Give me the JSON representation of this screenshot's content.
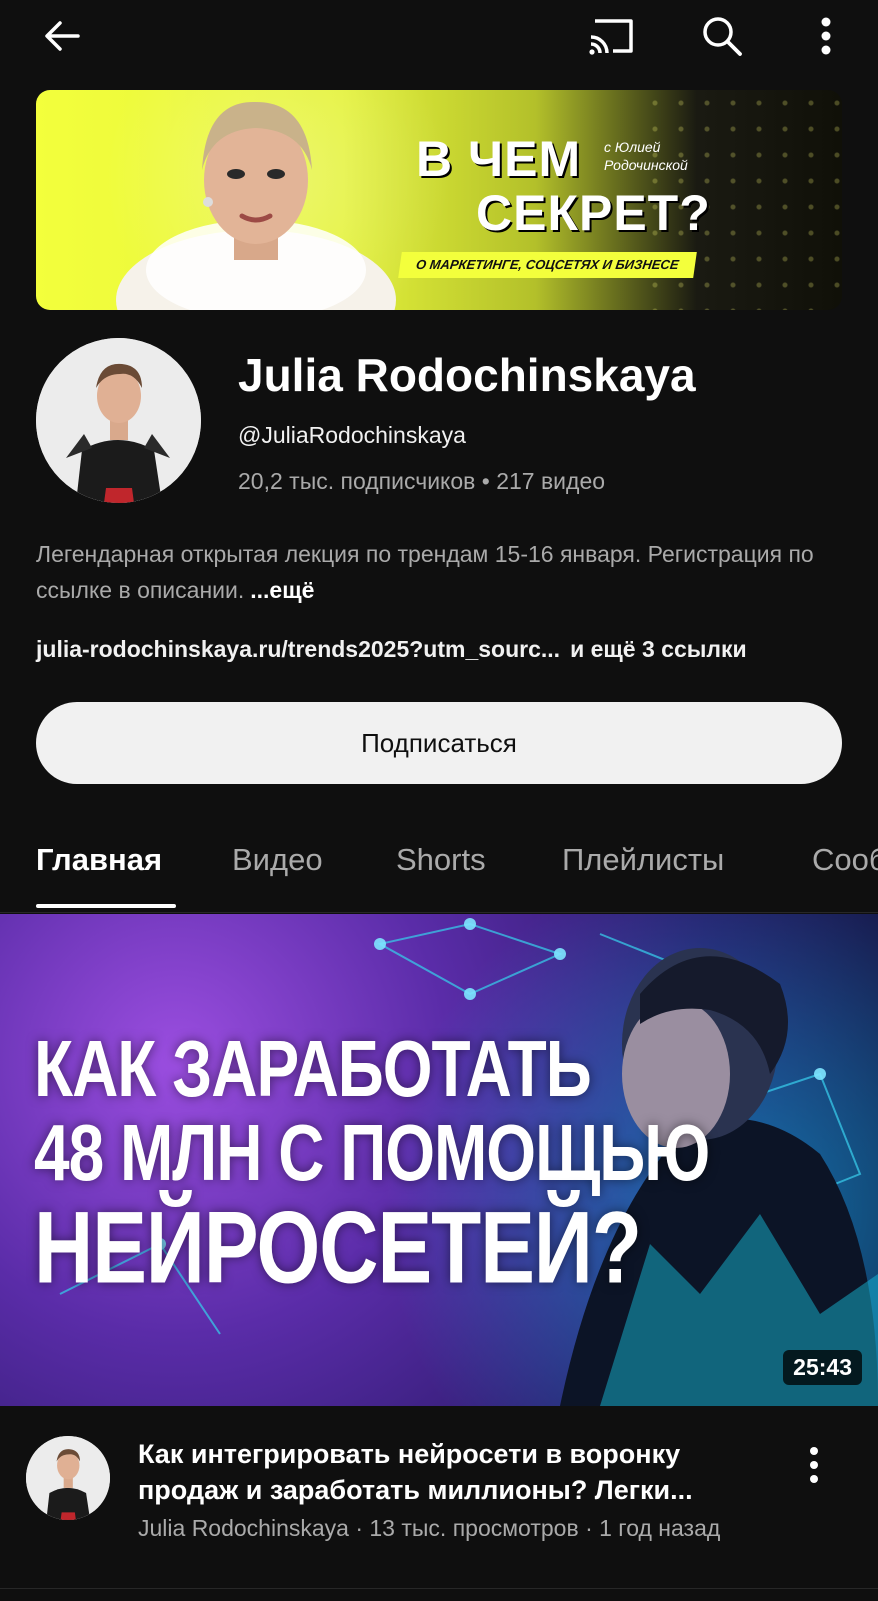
{
  "topbar": {
    "back_icon": "arrow-left-icon",
    "cast_icon": "cast-icon",
    "search_icon": "search-icon",
    "more_icon": "more-vert-icon"
  },
  "banner": {
    "title_line1": "В ЧЕМ",
    "title_line2": "СЕКРЕТ?",
    "with_text": "с Юлией Родочинской",
    "strip_text": "О МАРКЕТИНГЕ, СОЦСЕТЯХ И БИЗНЕСЕ",
    "accent_color": "#f3ff3c"
  },
  "channel": {
    "name": "Julia Rodochinskaya",
    "handle": "@JuliaRodochinskaya",
    "stats": "20,2 тыс. подписчиков • 217 видео",
    "description": "Легендарная открытая лекция по трендам 15-16 января. Регистрация по ссылке в описании.",
    "more_label": "...ещё",
    "link": "julia-rodochinskaya.ru/trends2025?utm_sourc...",
    "extra_links": "и ещё 3 ссылки",
    "subscribe_label": "Подписаться"
  },
  "tabs": [
    {
      "label": "Главная",
      "active": true
    },
    {
      "label": "Видео",
      "active": false
    },
    {
      "label": "Shorts",
      "active": false
    },
    {
      "label": "Плейлисты",
      "active": false
    },
    {
      "label": "Сообщество",
      "active": false
    }
  ],
  "featured_video": {
    "thumb_line1": "КАК ЗАРАБОТАТЬ",
    "thumb_line2": "48 МЛН С ПОМОЩЬЮ",
    "thumb_line3": "НЕЙРОСЕТЕЙ?",
    "duration": "25:43",
    "title": "Как интегрировать нейросети в воронку продаж и заработать миллионы? Легки...",
    "subtitle": "Julia Rodochinskaya · 13 тыс. просмотров · 1 год назад"
  }
}
